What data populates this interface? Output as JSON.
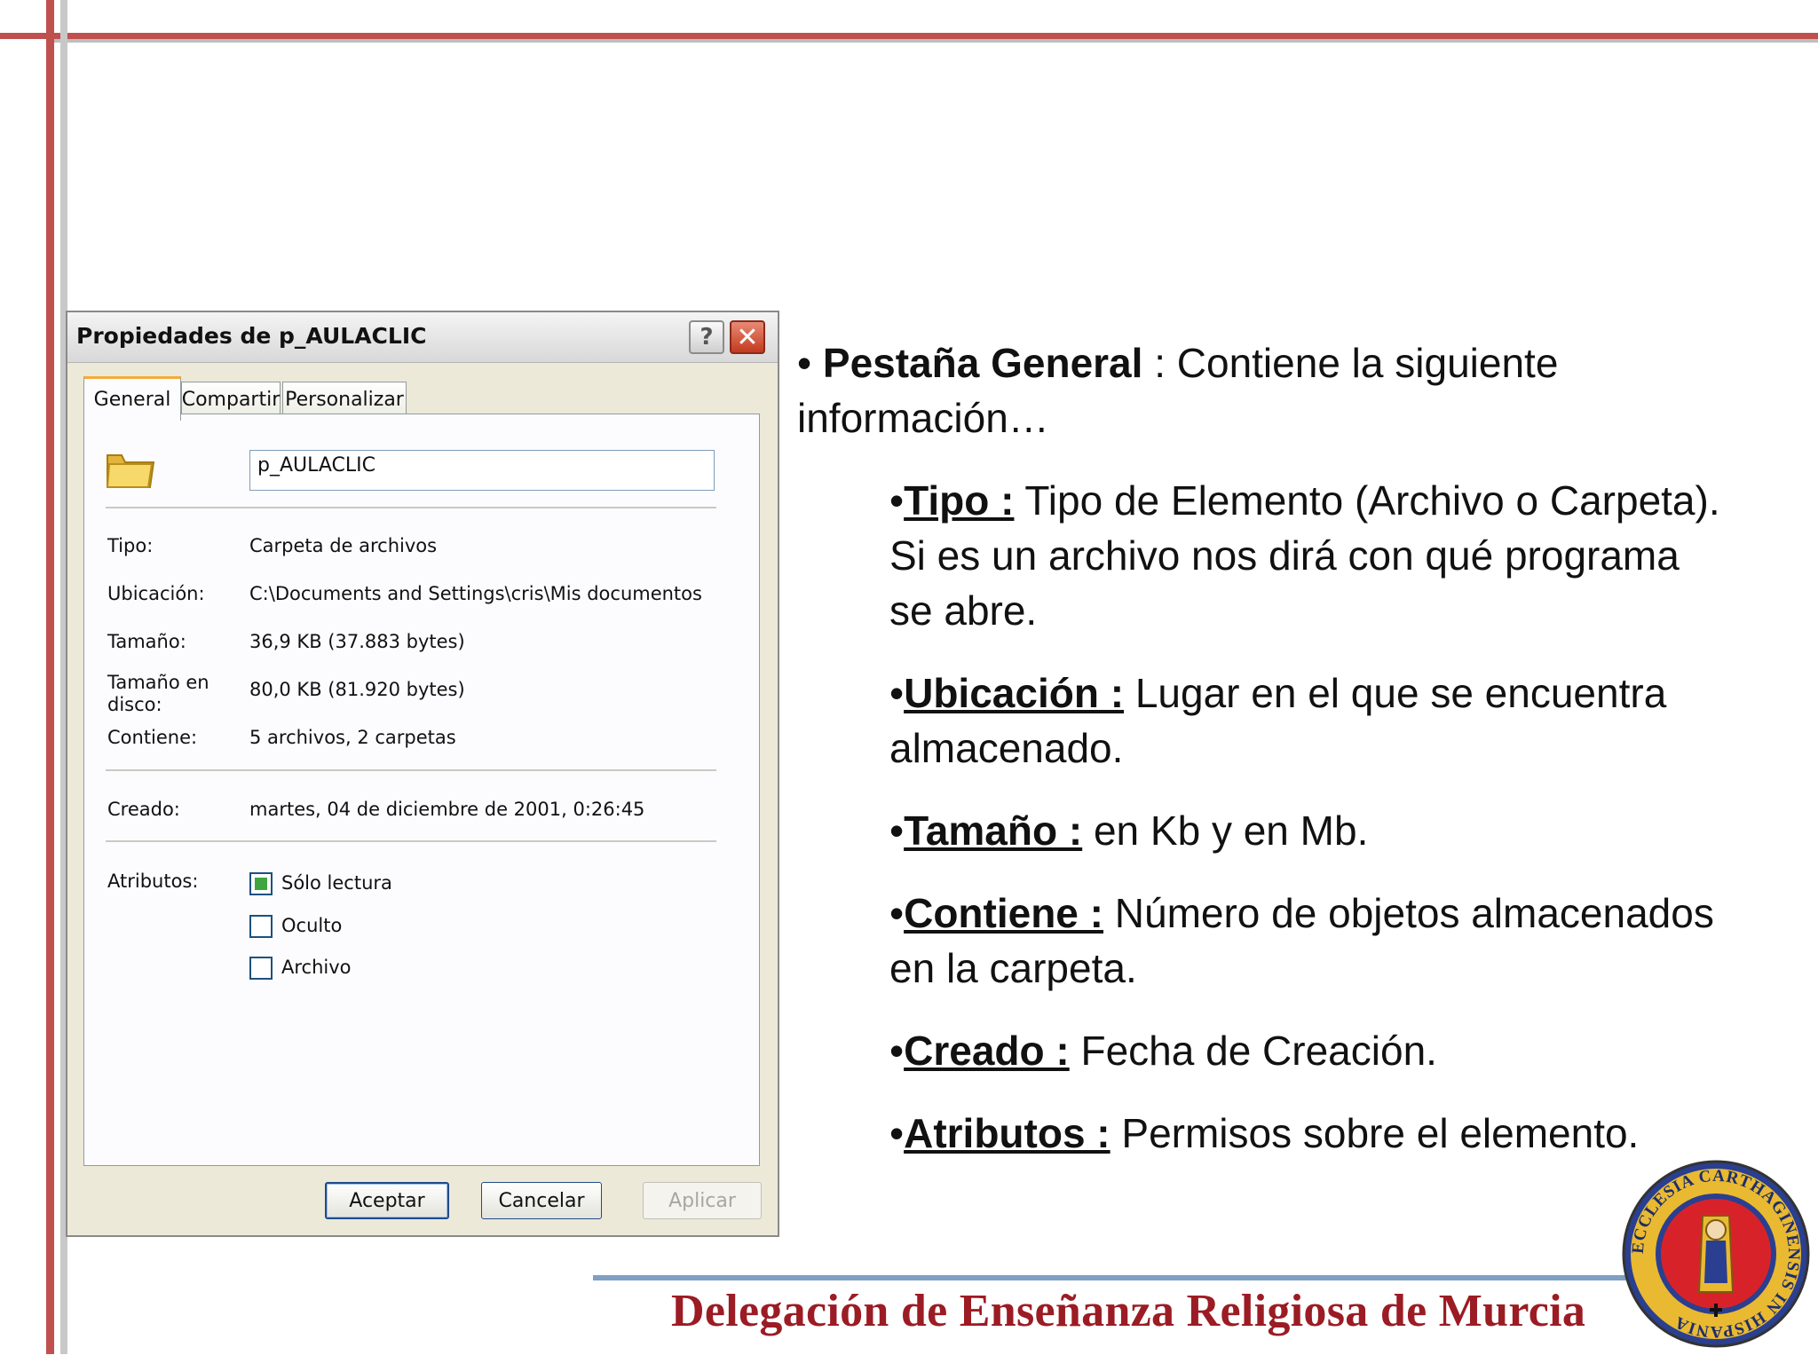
{
  "dialog": {
    "title": "Propiedades de p_AULACLIC",
    "help_label": "?",
    "close_label": "✕",
    "tabs": [
      "General",
      "Compartir",
      "Personalizar"
    ],
    "active_tab": "General",
    "name_value": "p_AULACLIC",
    "properties": [
      {
        "label": "Tipo:",
        "value": "Carpeta de archivos"
      },
      {
        "label": "Ubicación:",
        "value": "C:\\Documents and Settings\\cris\\Mis documentos"
      },
      {
        "label": "Tamaño:",
        "value": "36,9 KB (37.883 bytes)"
      },
      {
        "label": "Tamaño en disco:",
        "value": "80,0 KB (81.920 bytes)"
      },
      {
        "label": "Contiene:",
        "value": "5 archivos, 2 carpetas"
      },
      {
        "label": "Creado:",
        "value": "martes, 04 de diciembre de 2001, 0:26:45"
      },
      {
        "label": "Atributos:",
        "value": ""
      }
    ],
    "attributes": [
      {
        "label": "Sólo lectura",
        "checked": true
      },
      {
        "label": "Oculto",
        "checked": false
      },
      {
        "label": "Archivo",
        "checked": false
      }
    ],
    "buttons": {
      "ok": "Aceptar",
      "cancel": "Cancelar",
      "apply": "Aplicar"
    },
    "icons": {
      "folder": "folder-icon",
      "help": "help-icon",
      "close": "close-icon"
    }
  },
  "content": {
    "main_bullet_prefix": "• ",
    "main_term": "Pestaña General",
    "main_text": " : Contiene la siguiente información…",
    "items": [
      {
        "bullet": "•",
        "term": "Tipo :",
        "text": " Tipo de Elemento (Archivo o Carpeta). Si es un archivo nos dirá con qué programa se abre."
      },
      {
        "bullet": "•",
        "term": "Ubicación :",
        "text": " Lugar en el que se encuentra almacenado."
      },
      {
        "bullet": "•",
        "term": "Tamaño :",
        "text": " en Kb y en Mb."
      },
      {
        "bullet": "•",
        "term": "Contiene :",
        "text": " Número de objetos almacenados en la carpeta."
      },
      {
        "bullet": "•",
        "term": "Creado :",
        "text": " Fecha de Creación."
      },
      {
        "bullet": "•",
        "term": "Atributos :",
        "text": " Permisos sobre el elemento."
      }
    ]
  },
  "footer": {
    "text": "Delegación de Enseñanza Religiosa de Murcia",
    "seal_text": "ECCLESIA CARTHAGINENSIS IN HISPANIA"
  },
  "colors": {
    "accent_red": "#c0504d",
    "footer_text": "#9b1c24",
    "footer_line": "#7f9fc4"
  }
}
